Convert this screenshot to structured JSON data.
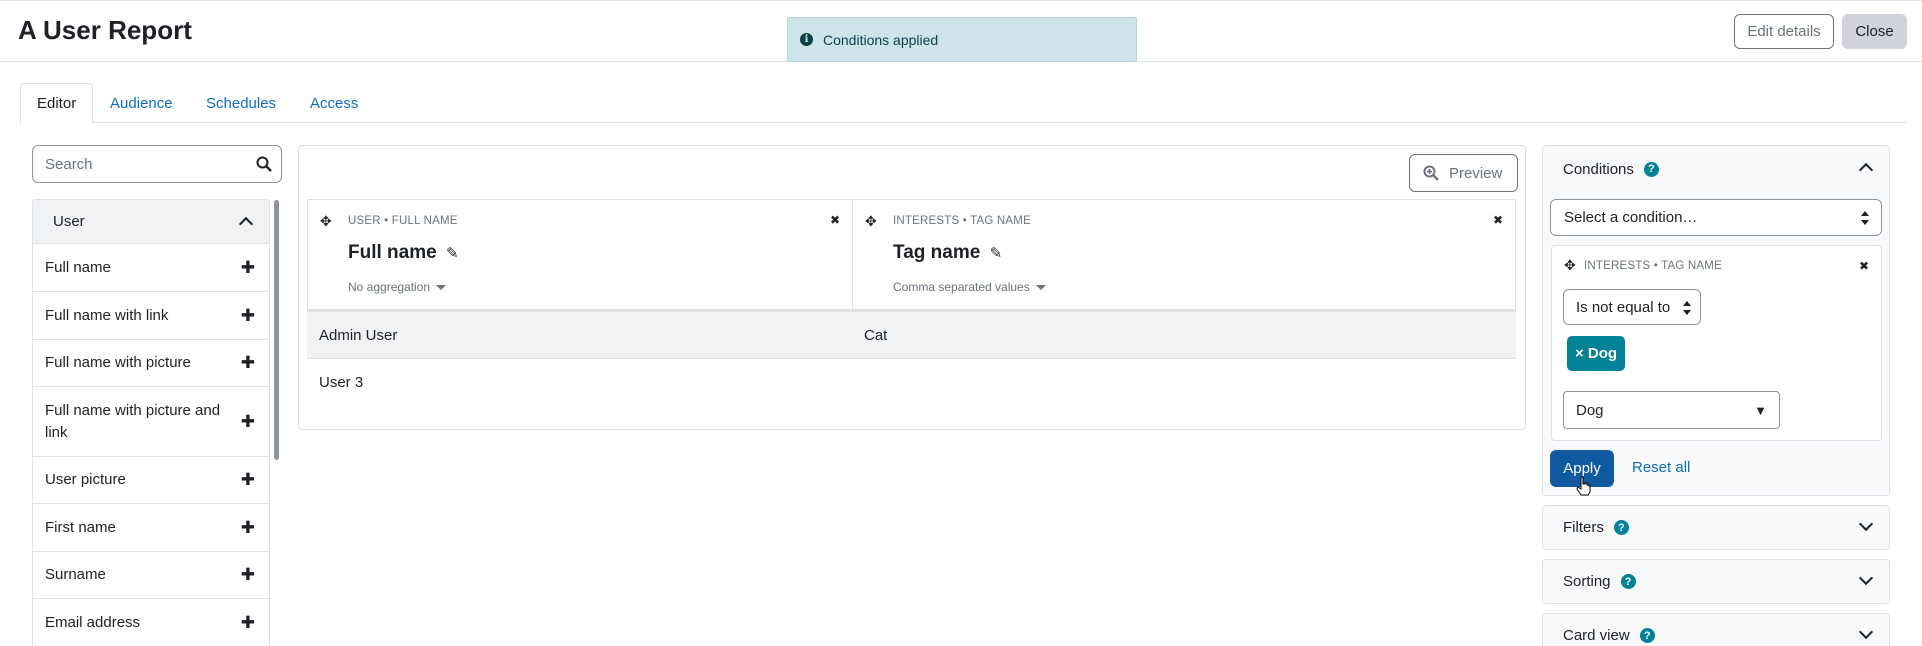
{
  "header": {
    "title": "A User Report",
    "edit_details": "Edit details",
    "close": "Close"
  },
  "toast": {
    "message": "Conditions applied",
    "icon": "info-icon"
  },
  "tabs": [
    {
      "label": "Editor",
      "active": true
    },
    {
      "label": "Audience",
      "active": false
    },
    {
      "label": "Schedules",
      "active": false
    },
    {
      "label": "Access",
      "active": false
    }
  ],
  "sidebar": {
    "search_placeholder": "Search",
    "group_label": "User",
    "items": [
      {
        "label": "Full name"
      },
      {
        "label": "Full name with link"
      },
      {
        "label": "Full name with picture"
      },
      {
        "label": "Full name with picture and link"
      },
      {
        "label": "User picture"
      },
      {
        "label": "First name"
      },
      {
        "label": "Surname"
      },
      {
        "label": "Email address"
      }
    ]
  },
  "report": {
    "preview_label": "Preview",
    "columns": [
      {
        "source": "USER • FULL NAME",
        "title": "Full name",
        "aggregation": "No aggregation"
      },
      {
        "source": "INTERESTS • TAG NAME",
        "title": "Tag name",
        "aggregation": "Comma separated values"
      }
    ],
    "rows": [
      [
        "Admin User",
        "Cat"
      ],
      [
        "User 3",
        ""
      ]
    ]
  },
  "conditions_panel": {
    "title": "Conditions",
    "select_placeholder": "Select a condition…",
    "condition": {
      "source": "INTERESTS • TAG NAME",
      "operator": "Is not equal to",
      "selected_tag": "× Dog",
      "value": "Dog"
    },
    "apply_label": "Apply",
    "reset_label": "Reset all"
  },
  "other_panels": [
    {
      "title": "Filters"
    },
    {
      "title": "Sorting"
    },
    {
      "title": "Card view"
    }
  ],
  "colors": {
    "link": "#0f6cbf",
    "primary": "#0f5aa1",
    "teal": "#008196",
    "toast_bg": "#cde4e9"
  }
}
